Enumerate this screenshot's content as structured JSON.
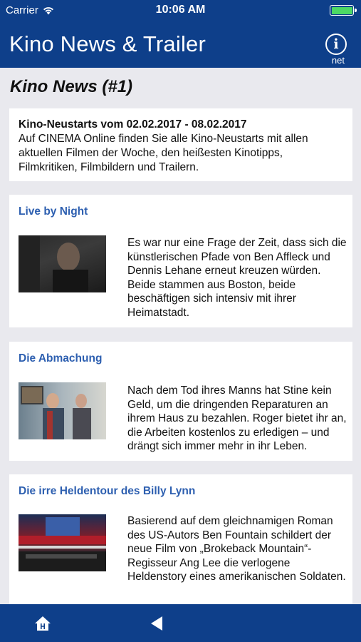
{
  "status": {
    "carrier": "Carrier",
    "time": "10:06 AM"
  },
  "navbar": {
    "title": "Kino News & Trailer",
    "info_label": "i",
    "info_sub": "net"
  },
  "section": {
    "title": "Kino News (#1)"
  },
  "intro": {
    "head": "Kino-Neustarts vom 02.02.2017 - 08.02.2017",
    "body": "Auf CINEMA Online finden Sie alle Kino-Neustarts mit allen aktuellen Filmen der Woche, den heißesten Kinotipps, Filmkritiken, Filmbildern und Trailern."
  },
  "news": [
    {
      "title": "Live by Night",
      "text": "Es war nur eine Frage der Zeit, dass sich die künstlerischen Pfade von Ben Affleck und Dennis Lehane erneut kreuzen würden. Beide stammen aus Boston, beide beschäftigen sich intensiv mit ihrer Heimatstadt."
    },
    {
      "title": "Die Abmachung",
      "text": "Nach dem Tod ihres Manns hat Stine kein Geld, um die dringenden Reparaturen an ihrem Haus zu bezahlen. Roger bietet ihr an, die Arbeiten kostenlos zu erledigen – und drängt sich immer mehr in ihr Leben."
    },
    {
      "title": "Die irre Heldentour des Billy Lynn",
      "text": "Basierend auf dem gleichnamigen Roman des US-Autors Ben Fountain schildert der neue Film von „Brokeback Mountain“-Regisseur Ang Lee die verlogene Heldenstory eines amerikanischen Soldaten."
    }
  ],
  "tabbar": {
    "home_icon": "home-icon",
    "back_icon": "back-arrow-icon"
  },
  "colors": {
    "brand": "#0e3f8a",
    "link": "#2d5fb0",
    "battery": "#4cd964"
  }
}
